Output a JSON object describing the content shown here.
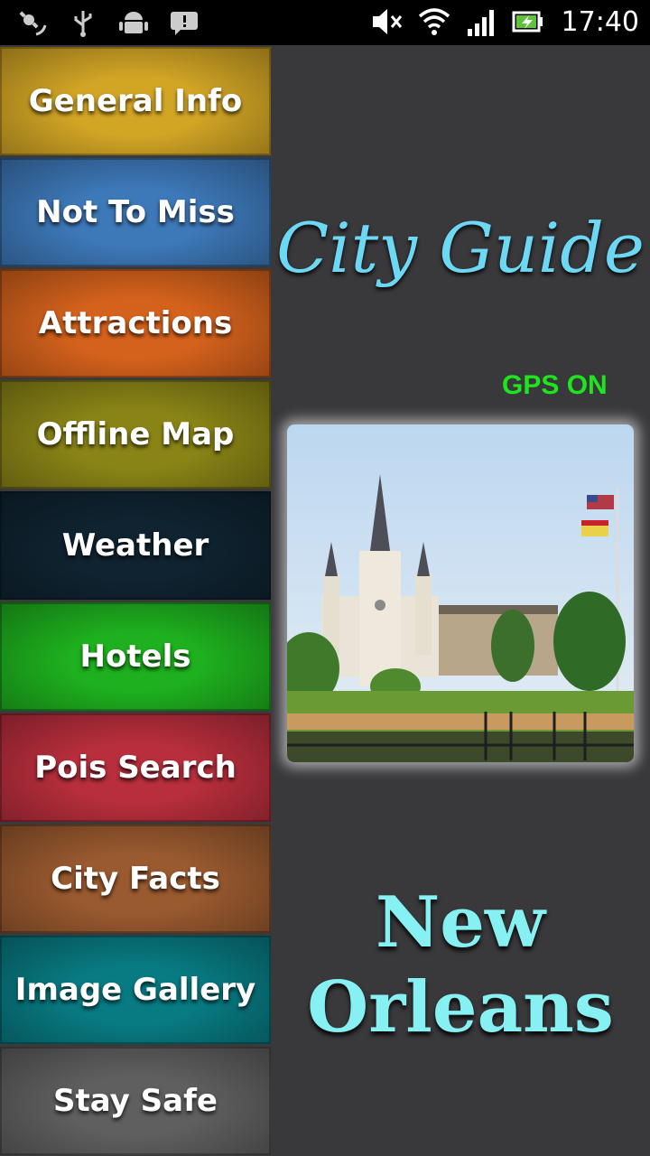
{
  "status_bar": {
    "left_icons": [
      "gps-satellite-icon",
      "usb-icon",
      "android-debug-icon",
      "message-icon"
    ],
    "right_icons": [
      "mute-icon",
      "wifi-icon",
      "signal-icon",
      "battery-charging-icon"
    ],
    "time": "17:40"
  },
  "menu": {
    "items": [
      {
        "label": "General Info",
        "color": "#d2a525"
      },
      {
        "label": "Not To Miss",
        "color": "#3d78b8"
      },
      {
        "label": "Attractions",
        "color": "#d5621c"
      },
      {
        "label": "Offline Map",
        "color": "#8a8416"
      },
      {
        "label": "Weather",
        "color": "#0f2330"
      },
      {
        "label": "Hotels",
        "color": "#1eb01e"
      },
      {
        "label": "Pois Search",
        "color": "#b82e3c"
      },
      {
        "label": "City Facts",
        "color": "#9a5a2f"
      },
      {
        "label": "Image Gallery",
        "color": "#087a82"
      },
      {
        "label": "Stay Safe",
        "color": "#5f5f5f"
      }
    ]
  },
  "main": {
    "title": "City Guide",
    "gps_status": "GPS ON",
    "city_line1": "New",
    "city_line2": "Orleans"
  }
}
